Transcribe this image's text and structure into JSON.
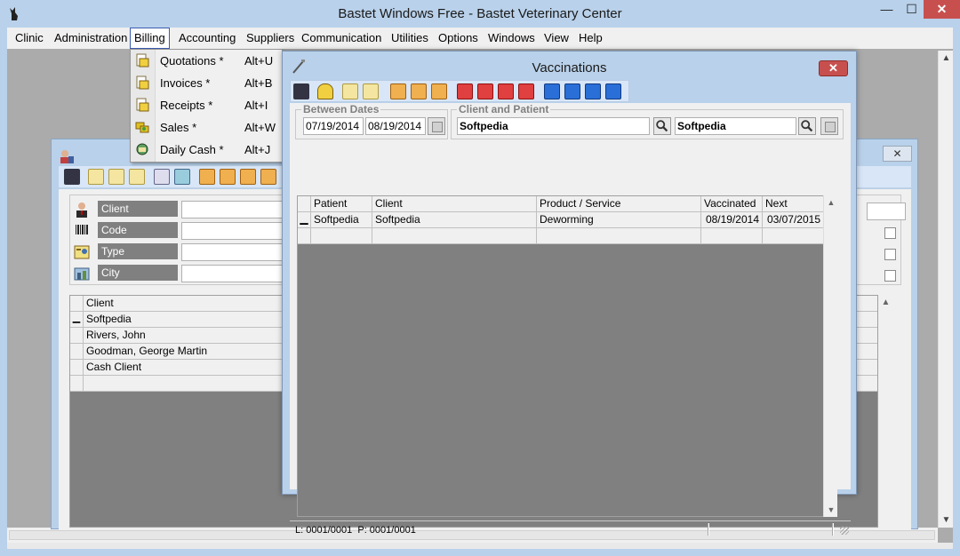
{
  "app": {
    "title": "Bastet Windows Free - Bastet Veterinary Center",
    "window_controls": {
      "minimize": "—",
      "maximize": "☐",
      "close": "✕"
    }
  },
  "menubar": {
    "items": [
      {
        "label": "Clinic"
      },
      {
        "label": "Administration"
      },
      {
        "label": "Billing"
      },
      {
        "label": "Accounting"
      },
      {
        "label": "Suppliers"
      },
      {
        "label": "Communication"
      },
      {
        "label": "Utilities"
      },
      {
        "label": "Options"
      },
      {
        "label": "Windows"
      },
      {
        "label": "View"
      },
      {
        "label": "Help"
      }
    ]
  },
  "billing_menu": {
    "items": [
      {
        "label": "Quotations *",
        "shortcut": "Alt+U",
        "icon": "quotation-icon"
      },
      {
        "label": "Invoices *",
        "shortcut": "Alt+B",
        "icon": "invoice-icon"
      },
      {
        "label": "Receipts *",
        "shortcut": "Alt+I",
        "icon": "receipt-icon"
      },
      {
        "label": "Sales *",
        "shortcut": "Alt+W",
        "icon": "sales-icon"
      },
      {
        "label": "Daily Cash *",
        "shortcut": "Alt+J",
        "icon": "daily-cash-icon"
      }
    ]
  },
  "clients_window": {
    "close_glyph": "✕",
    "filters": [
      {
        "label": "Client",
        "icon": "person-icon"
      },
      {
        "label": "Code",
        "icon": "barcode-icon"
      },
      {
        "label": "Type",
        "icon": "id-card-icon"
      },
      {
        "label": "City",
        "icon": "city-icon"
      }
    ],
    "grid": {
      "header": "Client",
      "rows": [
        "Softpedia",
        "Rivers, John",
        "Goodman, George Martin",
        "Cash Client",
        ""
      ]
    }
  },
  "vaccinations": {
    "title": "Vaccinations",
    "close_glyph": "✕",
    "between_dates": {
      "label": "Between Dates",
      "from": "07/19/2014",
      "to": "08/19/2014"
    },
    "client_patient": {
      "label": "Client and Patient",
      "client": "Softpedia",
      "patient": "Softpedia"
    },
    "grid": {
      "columns": [
        "Patient",
        "Client",
        "Product / Service",
        "Vaccinated",
        "Next"
      ],
      "rows": [
        [
          "Softpedia",
          "Softpedia",
          "Deworming",
          "08/19/2014",
          "03/07/2015"
        ]
      ]
    },
    "status": {
      "line": "L: 0001/0001",
      "page": "P: 0001/0001"
    }
  },
  "colors": {
    "title_bg": "#b9d1ea",
    "close_red": "#c7504f",
    "grid_bg": "#808080",
    "label_bg": "#808080"
  }
}
